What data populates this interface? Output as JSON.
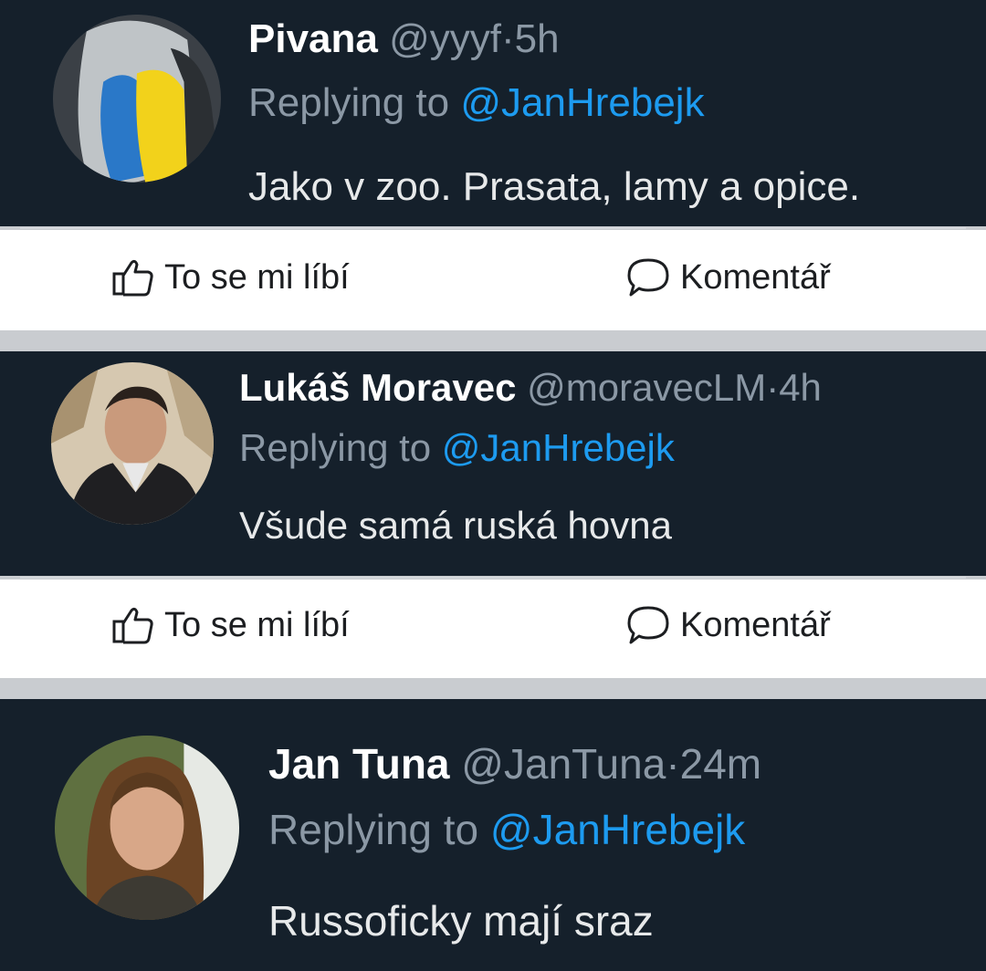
{
  "tweets": [
    {
      "name": "Pivana",
      "handle": "@yyyf",
      "dot": "·",
      "time": "5h",
      "replying_prefix": "Replying to ",
      "replying_to": "@JanHrebejk",
      "text": "Jako v zoo. Prasata, lamy a opice.",
      "avatar_icon": "avatar-blue-yellow-hair"
    },
    {
      "name": "Lukáš Moravec",
      "handle": "@moravecLM",
      "dot": "·",
      "time": "4h",
      "replying_prefix": "Replying to ",
      "replying_to": "@JanHrebejk",
      "text": "Všude samá ruská hovna",
      "avatar_icon": "avatar-man-suit"
    },
    {
      "name": "Jan Tuna",
      "handle": "@JanTuna",
      "dot": "·",
      "time": "24m",
      "replying_prefix": "Replying to ",
      "replying_to": "@JanHrebejk",
      "text": "Russoficky mají sraz",
      "avatar_icon": "avatar-long-hair-man"
    }
  ],
  "actions": [
    {
      "like_label": "To se mi líbí",
      "comment_label": "Komentář",
      "like_icon": "thumbs-up-icon",
      "comment_icon": "comment-bubble-icon"
    },
    {
      "like_label": "To se mi líbí",
      "comment_label": "Komentář",
      "like_icon": "thumbs-up-icon",
      "comment_icon": "comment-bubble-icon"
    }
  ],
  "colors": {
    "tweet_bg": "#15202b",
    "mention": "#1d9bf0",
    "muted": "#8b98a5",
    "separator": "#c9ccd0"
  }
}
